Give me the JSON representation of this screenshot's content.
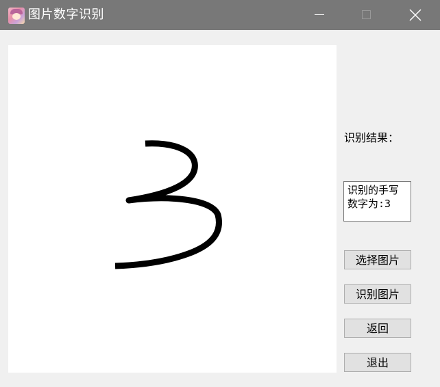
{
  "window": {
    "title": "图片数字识别",
    "controls": [
      "minimize",
      "maximize",
      "close"
    ]
  },
  "canvas": {
    "image": "handwritten-digit-3-icon",
    "background": "#ffffff",
    "stroke_color": "#000000"
  },
  "panel": {
    "result_label": "识别结果：",
    "result_text": "识别的手写数字为:3"
  },
  "buttons": {
    "select": "选择图片",
    "recognize": "识别图片",
    "back": "返回",
    "exit": "退出"
  },
  "colors": {
    "titlebar": "#787878",
    "window_bg": "#f0f0f0",
    "button_bg": "#e1e1e1"
  }
}
